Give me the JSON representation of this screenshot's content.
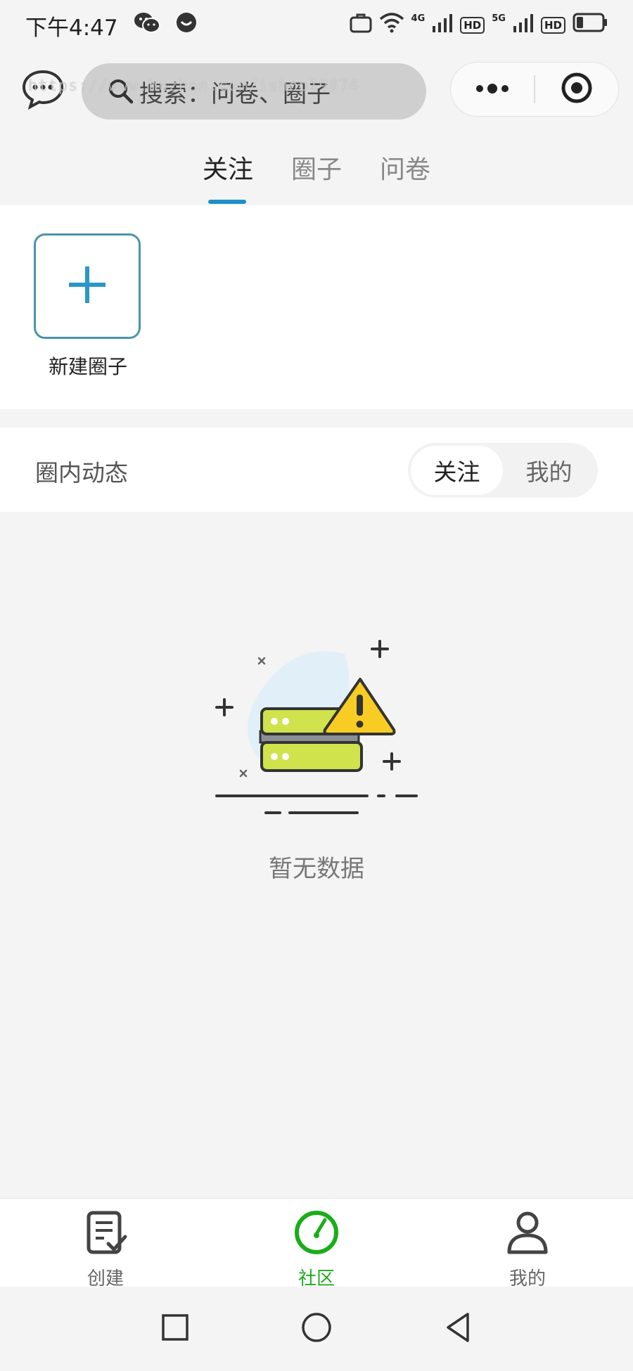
{
  "status_bar": {
    "time": "下午4:47",
    "net_4g": "4G",
    "net_5g": "5G",
    "hd1": "HD",
    "hd2": "HD"
  },
  "header": {
    "search_placeholder": "搜索：问卷、圈子",
    "watermark": "https://www.huzhan.com/ishop19874"
  },
  "top_tabs": [
    {
      "label": "关注",
      "active": true
    },
    {
      "label": "圈子",
      "active": false
    },
    {
      "label": "问卷",
      "active": false
    }
  ],
  "circles": {
    "new_circle_label": "新建圈子"
  },
  "feed": {
    "title": "圈内动态",
    "segments": [
      {
        "label": "关注",
        "active": true
      },
      {
        "label": "我的",
        "active": false
      }
    ],
    "empty_text": "暂无数据"
  },
  "tabbar": {
    "items": [
      {
        "label": "创建",
        "icon": "checklist-icon",
        "active": false
      },
      {
        "label": "社区",
        "icon": "gauge-icon",
        "active": true
      },
      {
        "label": "我的",
        "icon": "person-icon",
        "active": false
      }
    ]
  },
  "colors": {
    "accent_blue": "#1e8fc8",
    "active_green": "#1aad19",
    "plus_teal": "#2a97c8"
  }
}
